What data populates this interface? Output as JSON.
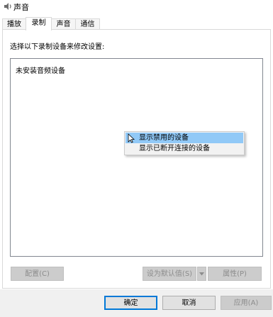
{
  "window": {
    "title": "声音",
    "icon": "speaker-icon"
  },
  "tabs": [
    {
      "label": "播放",
      "active": false
    },
    {
      "label": "录制",
      "active": true
    },
    {
      "label": "声音",
      "active": false
    },
    {
      "label": "通信",
      "active": false
    }
  ],
  "panel": {
    "instruction": "选择以下录制设备来修改设置:",
    "empty_text": "未安装音频设备"
  },
  "context_menu": {
    "items": [
      {
        "label": "显示禁用的设备",
        "highlighted": true
      },
      {
        "label": "显示已断开连接的设备",
        "highlighted": false
      }
    ]
  },
  "panel_buttons": {
    "configure": "配置(C)",
    "set_default": "设为默认值(S)",
    "properties": "属性(P)"
  },
  "dialog_buttons": {
    "ok": "确定",
    "cancel": "取消",
    "apply": "应用(A)"
  },
  "colors": {
    "menu_highlight": "#91c9f7",
    "focus_border": "#0078d7"
  }
}
